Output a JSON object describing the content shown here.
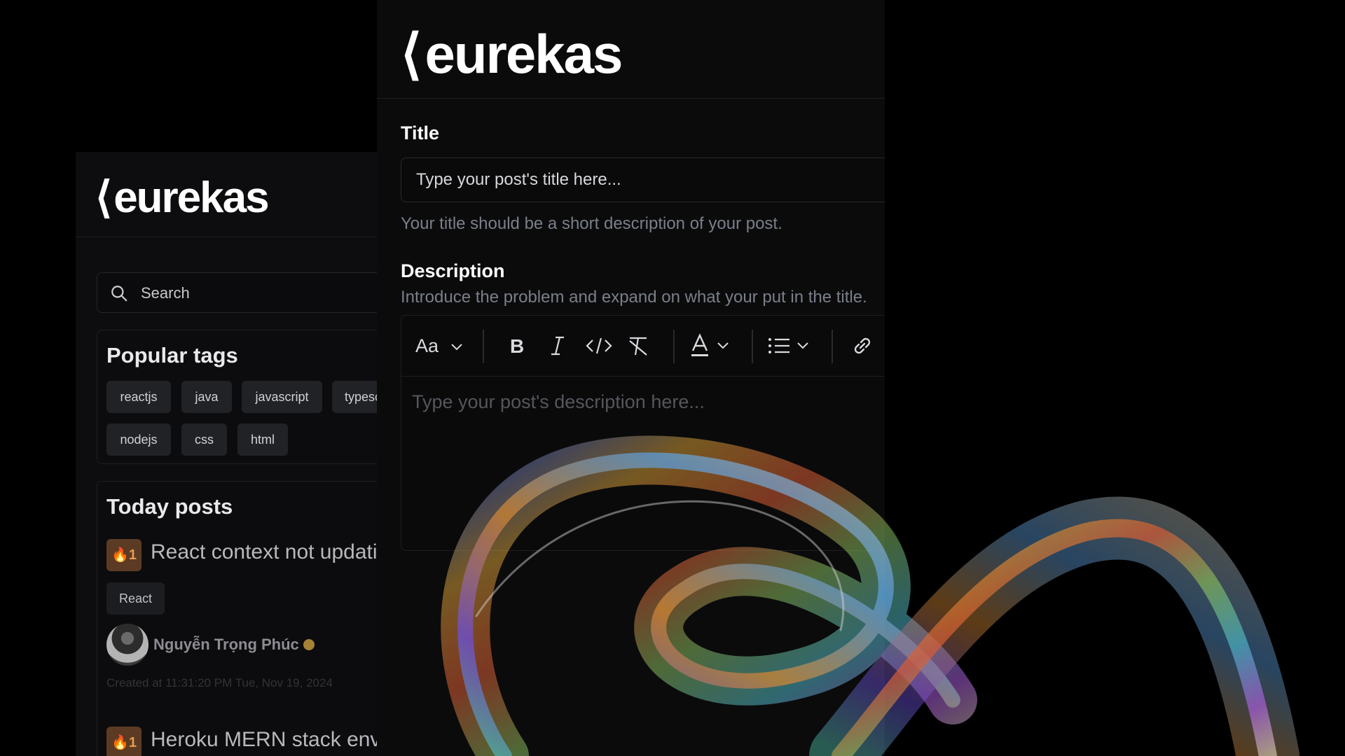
{
  "left_panel": {
    "logo_text": "eurekas",
    "search_placeholder": "Search",
    "popular_tags": {
      "heading": "Popular tags",
      "tags": [
        "reactjs",
        "java",
        "javascript",
        "typesc",
        "nodejs",
        "css",
        "html"
      ]
    },
    "today_posts": {
      "heading": "Today posts",
      "posts": [
        {
          "votes": "1",
          "title": "React context not updating",
          "tag": "React",
          "author": "Nguyễn Trọng Phúc",
          "created": "Created at 11:31:20 PM Tue, Nov 19, 2024"
        },
        {
          "votes": "1",
          "title": "Heroku MERN stack env v"
        }
      ]
    }
  },
  "editor_panel": {
    "logo_text": "eurekas",
    "title_label": "Title",
    "title_placeholder": "Type your post's title here...",
    "title_hint": "Your title should be a short description of your post.",
    "description_label": "Description",
    "description_hint": "Introduce the problem and expand on what your put in the title.",
    "description_placeholder": "Type your post's description here...",
    "toolbar": {
      "font_size_label": "Aa",
      "items": [
        "font-size-dropdown",
        "bold",
        "italic",
        "code",
        "clear-format",
        "text-color-dropdown",
        "list-dropdown",
        "link"
      ]
    }
  },
  "colors": {
    "page_background": "#000000",
    "panel_background": "#0b0b0c",
    "vote_badge": "#5c3b24",
    "vote_text": "#e79a55",
    "verified_badge": "#a68236"
  }
}
